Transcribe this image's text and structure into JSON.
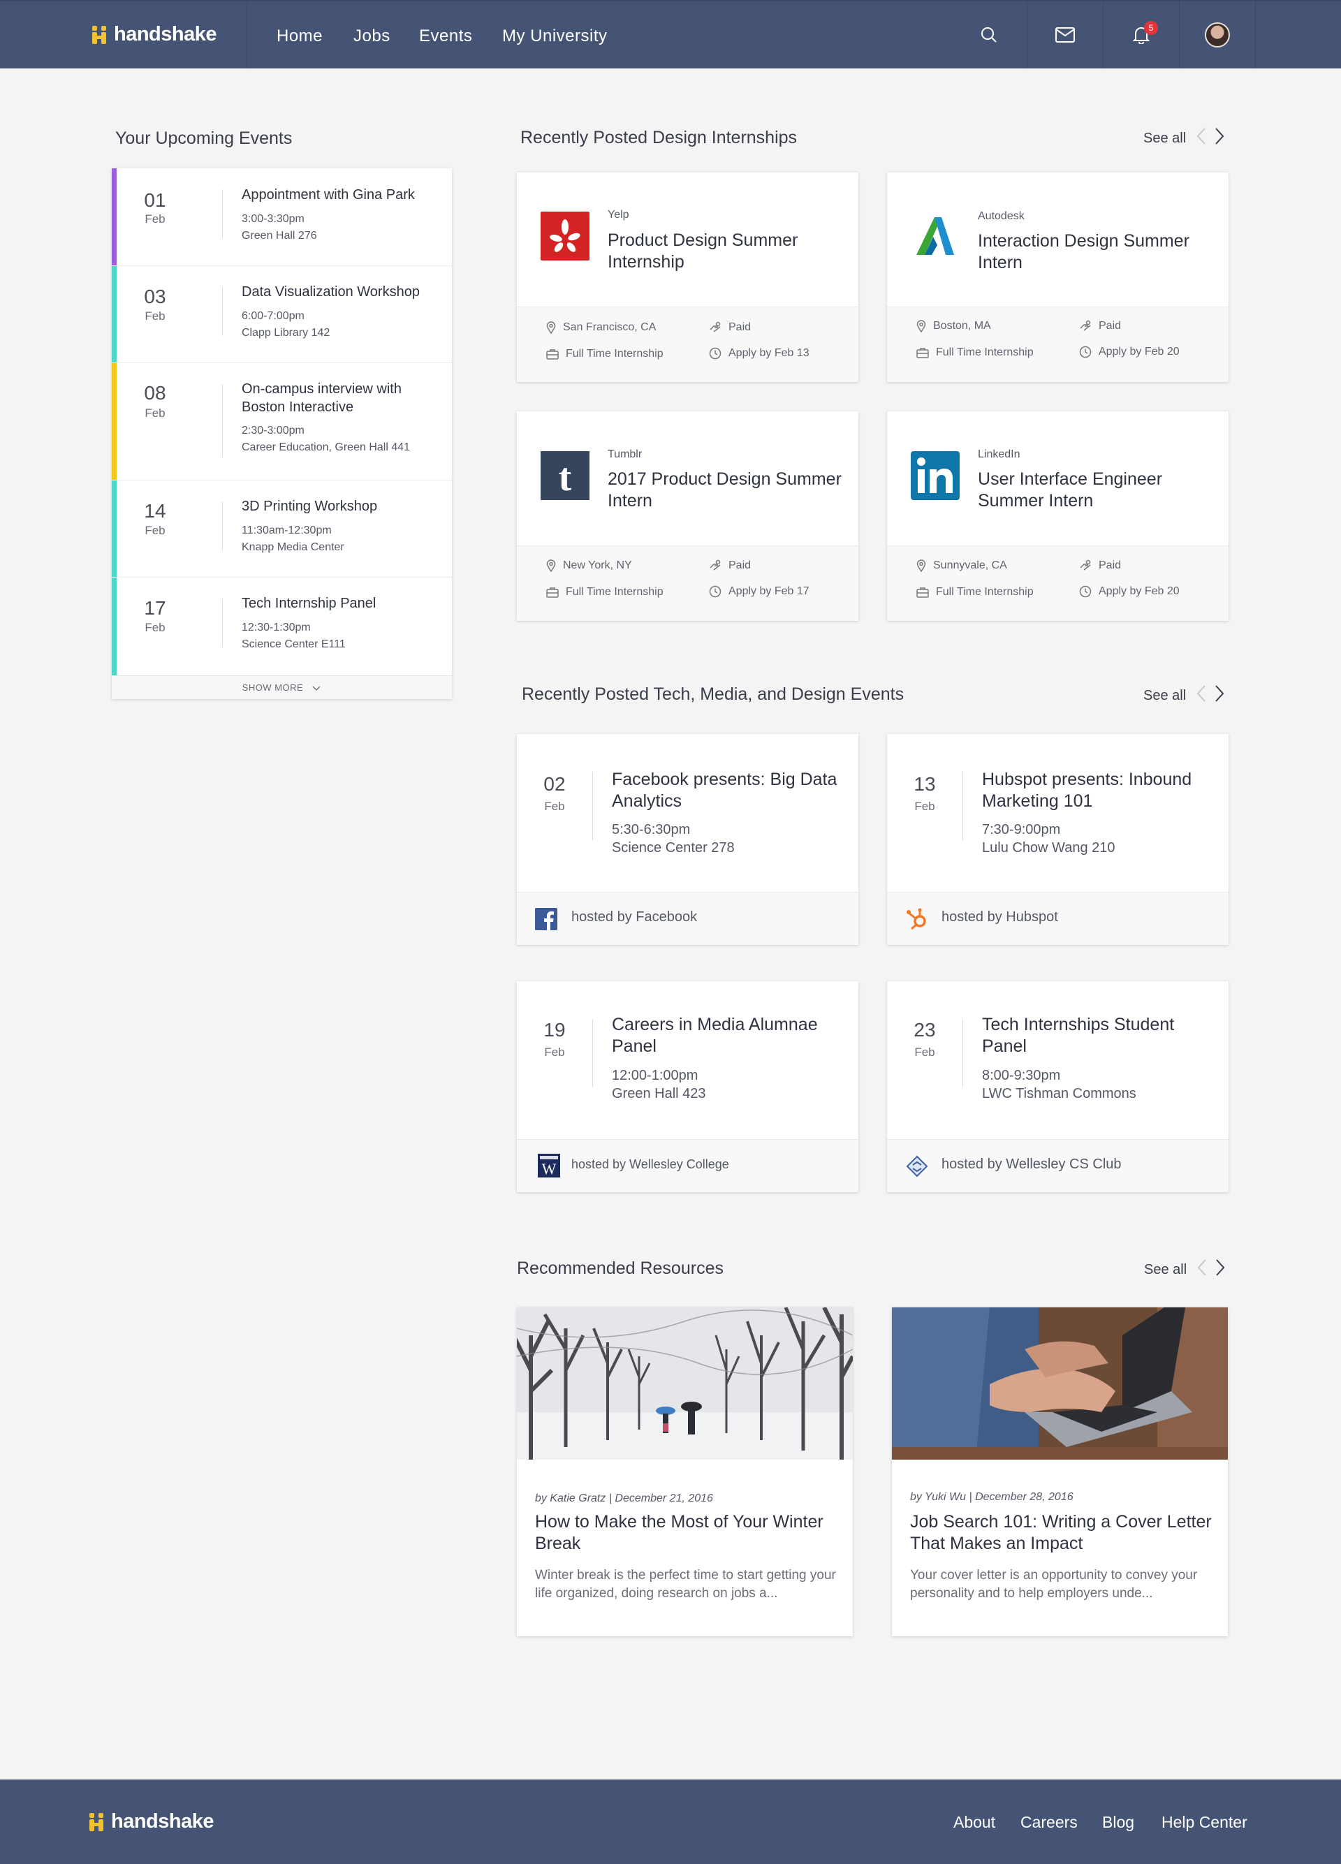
{
  "header": {
    "logo_text": "handshake",
    "nav": [
      "Home",
      "Jobs",
      "Events",
      "My University"
    ],
    "icons": [
      "search-icon",
      "mail-icon",
      "bell-icon"
    ],
    "notification_count": "5",
    "colors": {
      "bar": "#455474",
      "logo_mark": "#f2c230",
      "badge": "#e3343b"
    }
  },
  "upcoming": {
    "title": "Your Upcoming Events",
    "events": [
      {
        "day": "01",
        "month": "Feb",
        "title": "Appointment with Gina Park",
        "time": "3:00-3:30pm",
        "location": "Green Hall 276",
        "color": "#9b5fe0"
      },
      {
        "day": "03",
        "month": "Feb",
        "title": "Data Visualization Workshop",
        "time": "6:00-7:00pm",
        "location": "Clapp Library 142",
        "color": "#4fd6c8"
      },
      {
        "day": "08",
        "month": "Feb",
        "title": "On-campus interview with Boston Interactive",
        "time": "2:30-3:00pm",
        "location": "Career Education, Green Hall 441",
        "color": "#f2c918"
      },
      {
        "day": "14",
        "month": "Feb",
        "title": "3D Printing Workshop",
        "time": "11:30am-12:30pm",
        "location": "Knapp Media Center",
        "color": "#4fd6c8"
      },
      {
        "day": "17",
        "month": "Feb",
        "title": "Tech Internship Panel",
        "time": "12:30-1:30pm",
        "location": "Science Center E111",
        "color": "#4fd6c8"
      }
    ],
    "show_more": "SHOW MORE"
  },
  "internships": {
    "title": "Recently Posted Design Internships",
    "see_all": "See all",
    "jobs": [
      {
        "company": "Yelp",
        "title": "Product Design Summer Internship",
        "location": "San Francisco, CA",
        "pay": "Paid",
        "type": "Full Time Internship",
        "deadline": "Apply by Feb 13",
        "logo": "yelp-logo"
      },
      {
        "company": "Autodesk",
        "title": "Interaction Design Summer Intern",
        "location": "Boston, MA",
        "pay": "Paid",
        "type": "Full Time Internship",
        "deadline": "Apply by Feb 20",
        "logo": "autodesk-logo"
      },
      {
        "company": "Tumblr",
        "title": "2017 Product Design Summer Intern",
        "location": "New York, NY",
        "pay": "Paid",
        "type": "Full Time Internship",
        "deadline": "Apply by Feb 17",
        "logo": "tumblr-logo"
      },
      {
        "company": "LinkedIn",
        "title": "User Interface Engineer Summer Intern",
        "location": "Sunnyvale, CA",
        "pay": "Paid",
        "type": "Full Time Internship",
        "deadline": "Apply by Feb 20",
        "logo": "linkedin-logo"
      }
    ]
  },
  "events": {
    "title": "Recently Posted Tech, Media, and Design Events",
    "see_all": "See all",
    "items": [
      {
        "day": "02",
        "month": "Feb",
        "title": "Facebook presents: Big Data Analytics",
        "time": "5:30-6:30pm",
        "location": "Science Center 278",
        "host": "hosted by Facebook",
        "logo": "facebook-logo"
      },
      {
        "day": "13",
        "month": "Feb",
        "title": "Hubspot presents: Inbound Marketing 101",
        "time": "7:30-9:00pm",
        "location": "Lulu Chow Wang 210",
        "host": "hosted by Hubspot",
        "logo": "hubspot-logo"
      },
      {
        "day": "19",
        "month": "Feb",
        "title": "Careers in Media Alumnae Panel",
        "time": "12:00-1:00pm",
        "location": "Green Hall 423",
        "host": "hosted by Wellesley College",
        "logo": "wellesley-logo"
      },
      {
        "day": "23",
        "month": "Feb",
        "title": "Tech Internships Student Panel",
        "time": "8:00-9:30pm",
        "location": "LWC Tishman Commons",
        "host": "hosted by Wellesley CS Club",
        "logo": "cs-club-logo"
      }
    ]
  },
  "resources": {
    "title": "Recommended Resources",
    "see_all": "See all",
    "items": [
      {
        "author": "by Katie Gratz",
        "date": "December 21, 2016",
        "title": "How to Make the Most of Your Winter Break",
        "desc": "Winter break is the perfect time to start getting your life organized, doing research on jobs a...",
        "image": "snowy-park-photo"
      },
      {
        "author": "by Yuki Wu",
        "date": "December 28, 2016",
        "title": "Job Search 101: Writing a Cover Letter That Makes an Impact",
        "desc": "Your cover letter is an opportunity to convey your personality and to help employers unde...",
        "image": "laptop-typing-photo"
      }
    ]
  },
  "footer": {
    "logo_text": "handshake",
    "links": [
      "About",
      "Careers",
      "Blog",
      "Help Center"
    ]
  }
}
